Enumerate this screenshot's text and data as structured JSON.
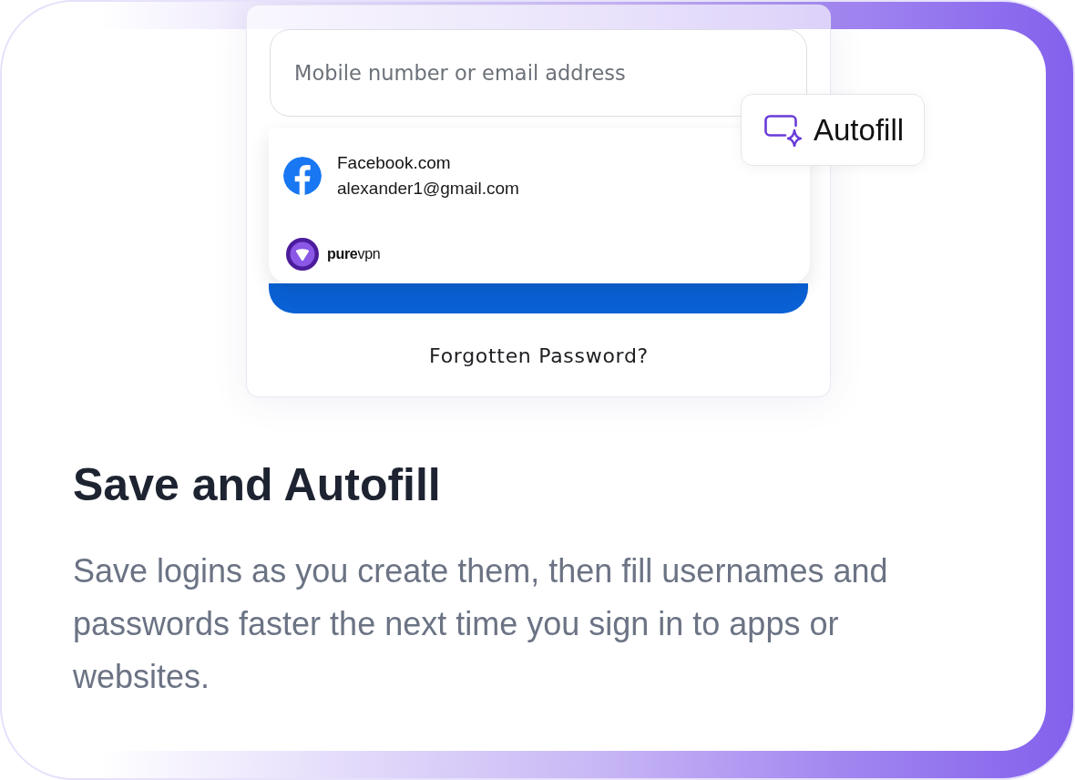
{
  "login_form": {
    "identifier_field": {
      "placeholder": "Mobile number or email address"
    },
    "suggestions": [
      {
        "kind": "account",
        "site": "Facebook.com",
        "account": "alexander1@gmail.com"
      },
      {
        "kind": "provider",
        "brand": "**pure**vpn"
      }
    ],
    "forgot_password_link": "Forgotten Password?"
  },
  "autofill_chip": {
    "label": "Autofill"
  },
  "feature": {
    "title": "Save and Autofill",
    "description": "Save logins as you create them, then fill usernames and passwords faster the next time you sign in to apps or websites."
  }
}
